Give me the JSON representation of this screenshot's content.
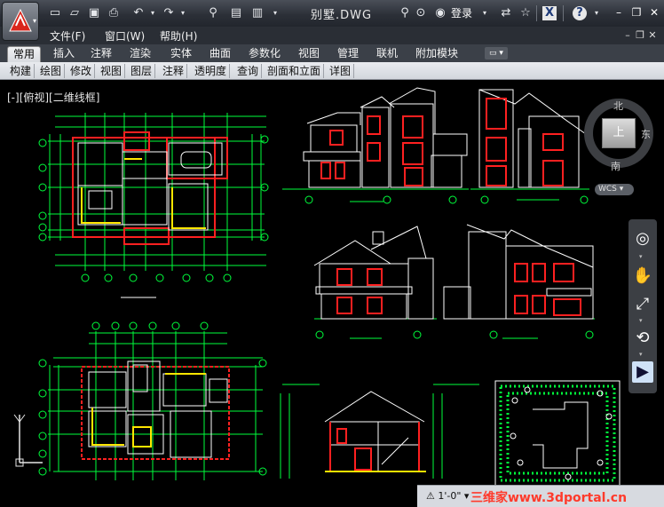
{
  "title_bar": {
    "document_title": "别墅.DWG",
    "login_label": "登录",
    "quick_access_icons": [
      "new-icon",
      "open-icon",
      "save-icon",
      "print-icon",
      "undo-icon",
      "redo-icon"
    ],
    "window_controls": [
      "minimize-icon",
      "restore-icon",
      "close-icon"
    ]
  },
  "menu_bar": {
    "items": [
      "文件(F)",
      "窗口(W)",
      "帮助(H)"
    ]
  },
  "ribbon_tabs": {
    "items": [
      "常用",
      "插入",
      "注释",
      "渲染",
      "实体",
      "曲面",
      "参数化",
      "视图",
      "管理",
      "联机",
      "附加模块"
    ],
    "active": "常用"
  },
  "ribbon_panels": {
    "items": [
      "构建",
      "绘图",
      "修改",
      "视图",
      "图层",
      "注释",
      "透明度",
      "查询",
      "剖面和立面",
      "详图"
    ]
  },
  "viewport": {
    "label": "[-][俯视][二维线框]"
  },
  "viewcube": {
    "top_label": "上",
    "north": "北",
    "east": "东",
    "south": "南",
    "ucs_label": "WCS"
  },
  "status_bar": {
    "annotation_scale": "1'-0\"",
    "watermark": "三维家www.3dportal.cn"
  },
  "colors": {
    "background": "#000000",
    "wall_red": "#ff2020",
    "grid_green": "#00ff3c",
    "wall_white": "#ffffff",
    "wall_yellow": "#ffe600"
  }
}
